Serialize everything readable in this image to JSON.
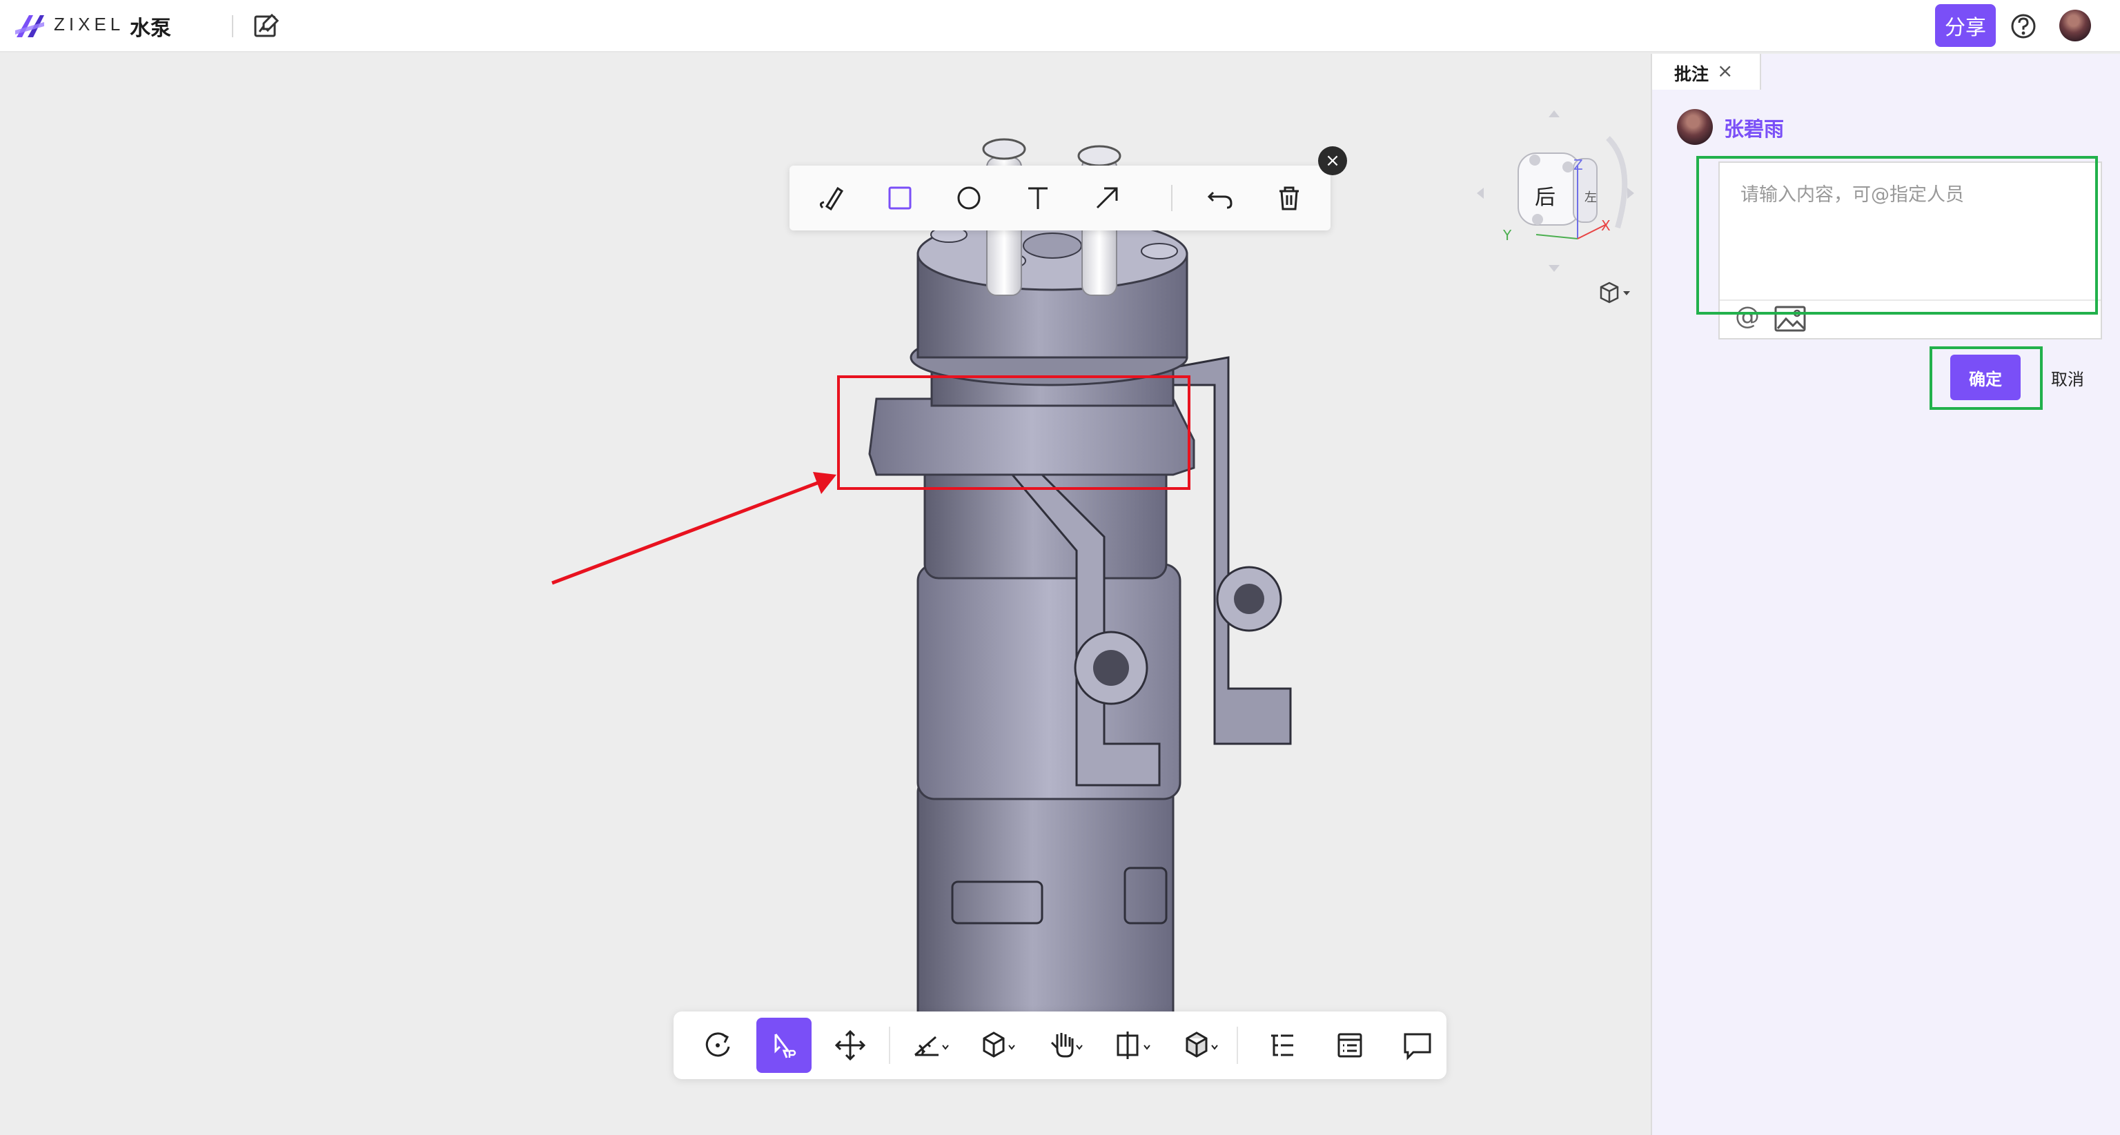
{
  "header": {
    "brand": "ZIXEL",
    "doc_title": "水泵",
    "share_label": "分享",
    "help_icon": "help-circle-icon",
    "edit_icon": "edit-image-icon"
  },
  "annotation_toolbar": {
    "tools": [
      "pen-icon",
      "rectangle-icon",
      "circle-icon",
      "text-icon",
      "arrow-icon",
      "undo-icon",
      "trash-icon"
    ],
    "active_tool": "rectangle-icon",
    "close_label": "×"
  },
  "view_cube": {
    "face_label": "后",
    "side_label": "左",
    "axes": [
      "Z",
      "Y",
      "X"
    ]
  },
  "bottom_toolbar": {
    "tools": [
      "rotate-icon",
      "select-icon",
      "move-icon",
      "measure-icon",
      "explode-icon",
      "hide-icon",
      "section-icon",
      "display-mode-icon",
      "tree-icon",
      "properties-icon",
      "comment-icon"
    ],
    "active_tool": "select-icon"
  },
  "panel": {
    "tab_label": "批注",
    "tab_close": "×",
    "user_name": "张碧雨",
    "input_placeholder": "请输入内容，可@指定人员",
    "at_symbol": "@",
    "confirm_label": "确定",
    "cancel_label": "取消"
  },
  "colors": {
    "accent": "#7a4ff7",
    "annotation_red": "#e8121f",
    "highlight_green": "#22b14c",
    "model_metal": "#8f8fa3"
  }
}
